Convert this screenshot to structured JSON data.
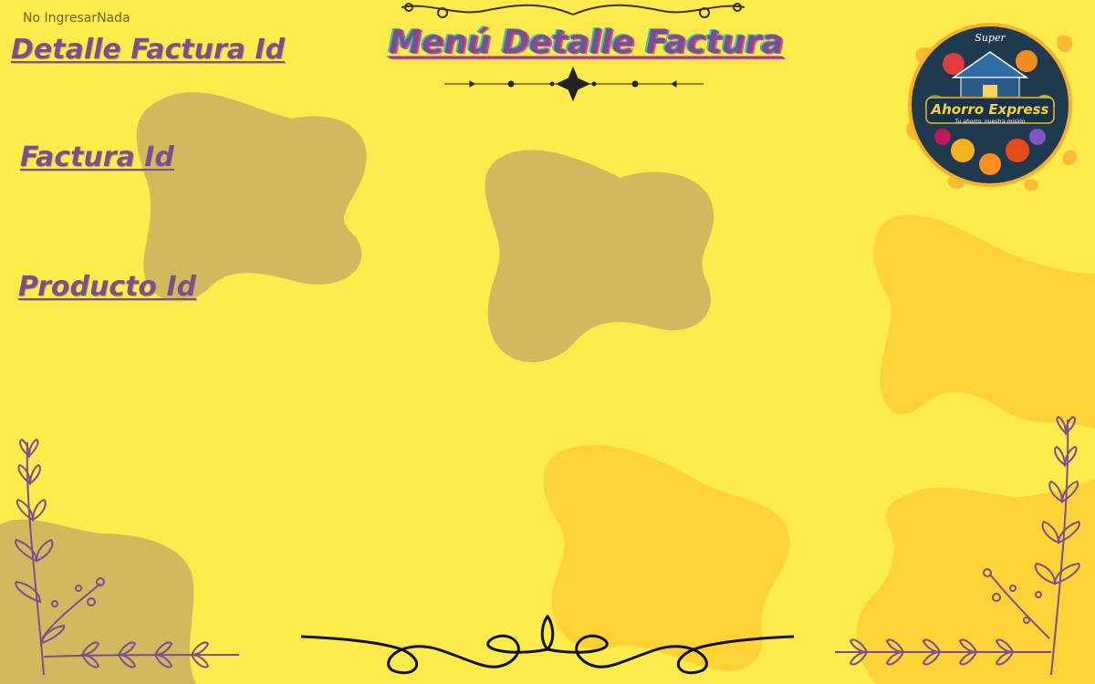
{
  "hint_text": "No IngresarNada",
  "title": "Menú Detalle Factura",
  "labels": {
    "detalle_factura_id": "Detalle Factura Id",
    "factura_id": "Factura Id",
    "producto_id": "Producto Id"
  },
  "logo": {
    "brand": "Ahorro Express",
    "tagline": "Tu ahorro, nuestra misión",
    "badge": "Super"
  },
  "colors": {
    "background": "#fdeb4b",
    "label_purple": "#7a4f8e",
    "blob_olive": "#d4b85e",
    "blob_orange": "#fdd236"
  }
}
